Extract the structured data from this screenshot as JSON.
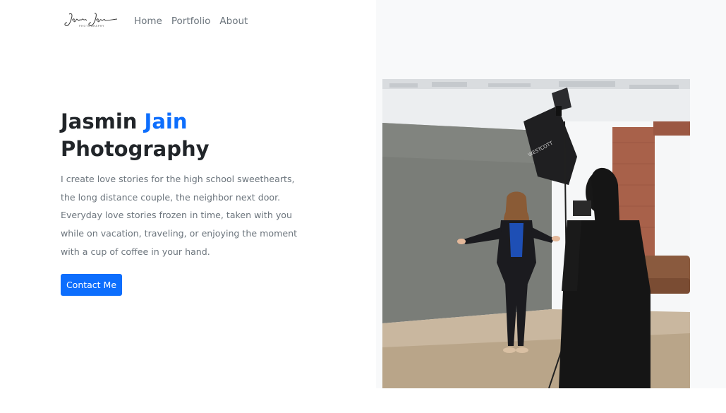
{
  "nav": {
    "logo_name": "Jasmin Jain",
    "logo_sub": "PHOTOGRAPHY",
    "links": [
      {
        "label": "Home"
      },
      {
        "label": "Portfolio"
      },
      {
        "label": "About"
      }
    ]
  },
  "hero": {
    "title_first": "Jasmin",
    "title_accent": "Jain",
    "title_second": "Photography",
    "description": "I create love stories for the high school sweethearts, the long distance couple, the neighbor next door. Everyday love stories frozen in time, taken with you while on vacation, traveling, or enjoying the moment with a cup of coffee in your hand.",
    "cta_label": "Contact Me"
  },
  "photo": {
    "softbox_brand": "WESTCOTT"
  },
  "colors": {
    "accent": "#0d6efd",
    "muted": "#6c757d",
    "panel": "#f8f9fa"
  }
}
